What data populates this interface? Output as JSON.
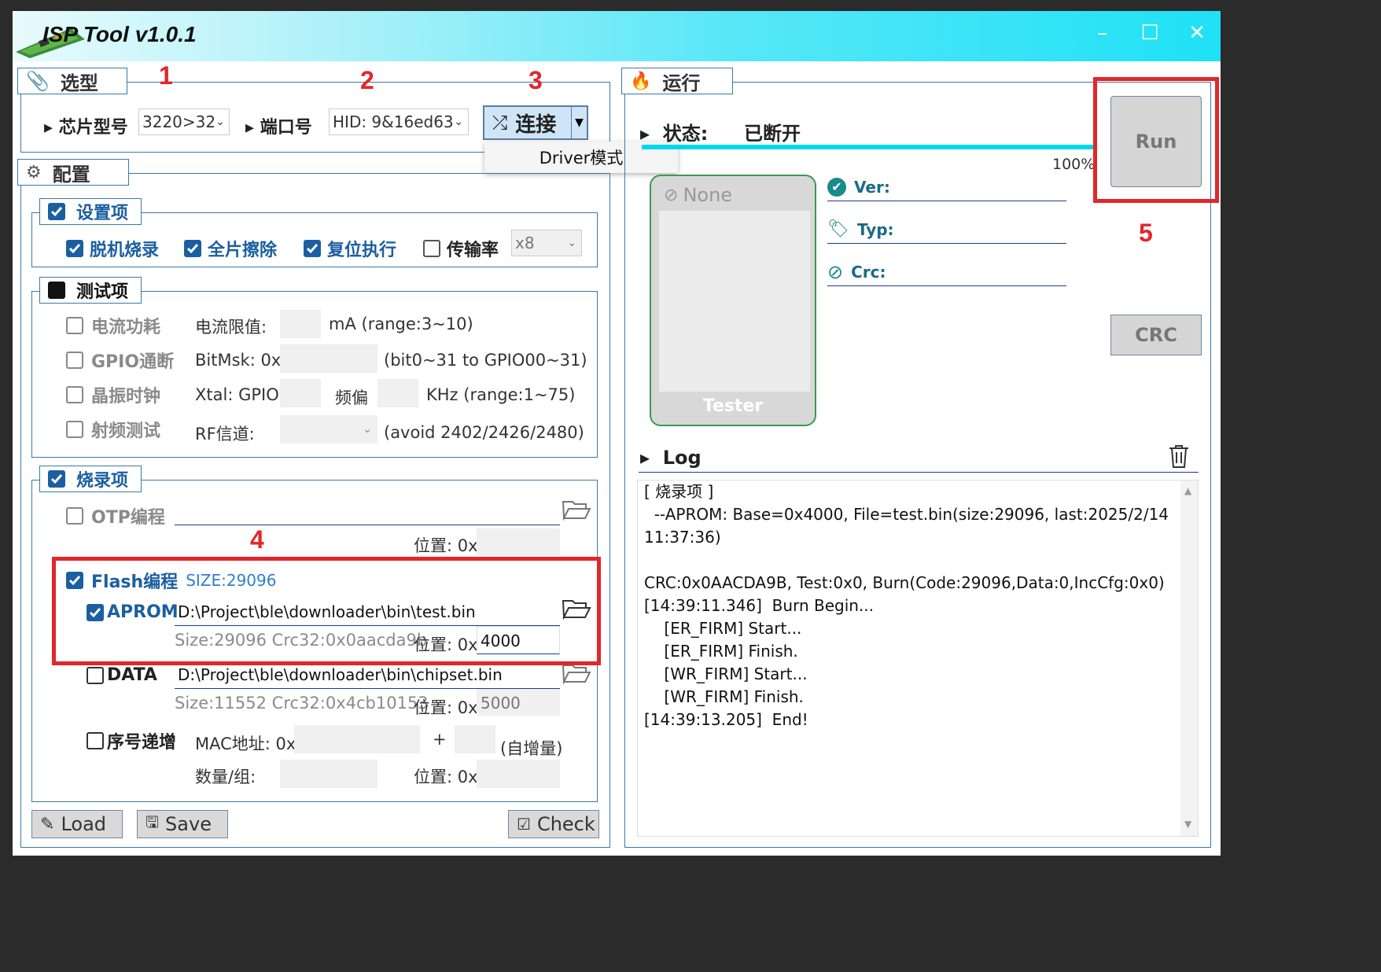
{
  "window": {
    "title": "ISP Tool v1.0.1",
    "minimize": "–",
    "maximize": "☐",
    "close": "✕"
  },
  "select_section": {
    "tab_label": "选型",
    "chip_label": "芯片型号",
    "chip_value": "3220>32",
    "port_label": "端口号",
    "port_value": "HID: 9&16ed63",
    "connect_label": "连接",
    "dropdown_item": "Driver模式"
  },
  "config_section": {
    "tab_label": "配置",
    "settings": {
      "label": "设置项",
      "offline_burn": "脱机烧录",
      "full_erase": "全片擦除",
      "reset_exec": "复位执行",
      "baud_label": "传输率",
      "baud_value": "x8"
    },
    "tests": {
      "label": "测试项",
      "current": "电流功耗",
      "current_limit_label": "电流限值:",
      "current_unit": "mA  (range:3~10)",
      "gpio": "GPIO通断",
      "bitmask_label": "BitMsk: 0x",
      "bitmask_hint": "(bit0~31 to GPIO00~31)",
      "crystal": "晶振时钟",
      "xtal_label": "Xtal:  GPIO",
      "offset_label": "频偏",
      "offset_hint": "KHz (range:1~75)",
      "rf": "射频测试",
      "rf_channel_label": "RF信道:",
      "rf_hint": "(avoid 2402/2426/2480)"
    },
    "burn": {
      "label": "烧录项",
      "otp": "OTP编程",
      "otp_pos_label": "位置: 0x",
      "flash": "Flash编程",
      "flash_size": "SIZE:29096",
      "aprom": "APROM",
      "aprom_path": "D:\\Project\\ble\\downloader\\bin\\test.bin",
      "aprom_info": "Size:29096  Crc32:0x0aacda9b",
      "aprom_pos_label": "位置: 0x",
      "aprom_pos": "4000",
      "data": "DATA",
      "data_path": "D:\\Project\\ble\\downloader\\bin\\chipset.bin",
      "data_info": "Size:11552  Crc32:0x4cb10153",
      "data_pos_label": "位置: 0x",
      "data_pos": "5000",
      "serial": "序号递增",
      "mac_label": "MAC地址: 0x",
      "plus": "+",
      "auto_inc": "(自增量)",
      "qty_label": "数量/组:",
      "serial_pos_label": "位置: 0x"
    },
    "load": "Load",
    "save": "Save",
    "check": "Check"
  },
  "run_section": {
    "tab_label": "运行",
    "status_label": "状态:",
    "status_value": "已断开",
    "progress_text": "100%",
    "progress": 1.0,
    "tester_status": "None",
    "tester_label": "Tester",
    "ver_label": "Ver:",
    "typ_label": "Typ:",
    "crc_label": "Crc:",
    "run_button": "Run",
    "crc_button": "CRC",
    "log_label": "Log",
    "log_lines": [
      "[ 烧录项 ]",
      "  --APROM: Base=0x4000, File=test.bin(size:29096, last:2025/2/14",
      "11:37:36)",
      "",
      "CRC:0x0AACDA9B, Test:0x0, Burn(Code:29096,Data:0,IncCfg:0x0)",
      "[14:39:11.346]  Burn Begin...",
      "    [ER_FIRM] Start...",
      "    [ER_FIRM] Finish.",
      "    [WR_FIRM] Start...",
      "    [WR_FIRM] Finish.",
      "[14:39:13.205]  End!"
    ]
  },
  "annotations": {
    "n1": "1",
    "n2": "2",
    "n3": "3",
    "n4": "4",
    "n5": "5"
  },
  "colors": {
    "accent": "#1b5fa0",
    "highlight": "#e3262b",
    "titlebar": "#1fe1f6",
    "progress": "#00d8f0"
  }
}
